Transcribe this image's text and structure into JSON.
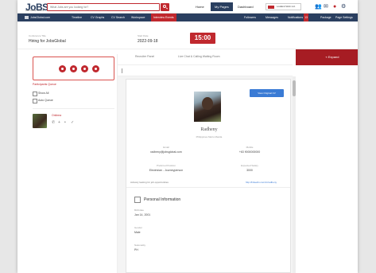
{
  "brand": {
    "logo_text_main": "JoBS",
    "logo_tagline": "Jobs Global Network"
  },
  "search": {
    "placeholder": "What Jobs are you looking for?"
  },
  "top_nav": {
    "home": "Home",
    "my_pages": "My Pages",
    "dashboard": "Dashboard",
    "account": "LowEnd Web Ltd."
  },
  "sub_nav": {
    "items": [
      "JobsGlobal.com",
      "Timeline",
      "CV Graphs",
      "CV Search",
      "Workspace",
      "Interview Events",
      "Followers",
      "Messages",
      "Notifications",
      "Package",
      "Page Settings"
    ],
    "notifications_count": "13"
  },
  "header": {
    "company_label": "Conference Title",
    "company_value": "Hiring for JobsGlobal",
    "date_label": "Start Date",
    "date_value": "2022-09-18",
    "timer": "15:00"
  },
  "left_panel": {
    "queue_title": "Participants Queue",
    "show_all": "Show All",
    "auto_queue": "Auto Queue",
    "participant_name": "Onlinea"
  },
  "center": {
    "tab_recruiter": "Recruiter Panel",
    "tab_live": "Live Chat & Calling Waiting Room",
    "view_cv": "View Original CV",
    "candidate_name": "Radheny",
    "candidate_location": "Philippines Metro Manila",
    "fields": [
      {
        "label": "Email",
        "value": "radheny@jobsglobal.com"
      },
      {
        "label": "Mobile",
        "value": "+63 9000000000"
      },
      {
        "label": "Preferred Position",
        "value": "Electrician - Journeyperson"
      },
      {
        "label": "Expected Salary",
        "value": "3000"
      }
    ],
    "looking_text": "Actively looking for job opportunities",
    "linkedin_text": "http://linkedin.com/in/radheny",
    "personal_title": "Personal Information",
    "personal": [
      {
        "label": "Birthdate",
        "value": "Jan 14, 2001"
      },
      {
        "label": "Gender",
        "value": "Male"
      },
      {
        "label": "Nationality",
        "value": "PH"
      }
    ]
  },
  "right_panel": {
    "expand_label": "Expand"
  },
  "colors": {
    "brand_red": "#c0282e",
    "navy": "#2a3f60",
    "link_blue": "#3a7bd5"
  }
}
